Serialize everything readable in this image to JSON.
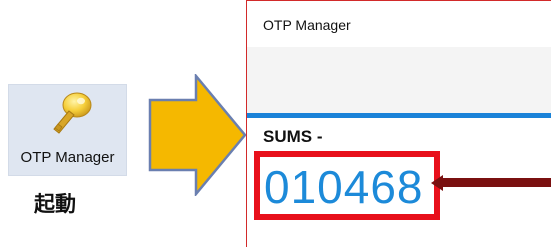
{
  "desktop": {
    "shortcut_label": "OTP Manager",
    "launch_label": "起動"
  },
  "window": {
    "title": "OTP Manager",
    "account_name": "SUMS -",
    "otp_code": "010468"
  },
  "colors": {
    "accent_line": "#1a82d8",
    "otp_text": "#1c8ad9",
    "highlight_box": "#e8101b",
    "pointer": "#7a1010",
    "arrow_fill": "#f5b800",
    "arrow_stroke": "#6a7fb0"
  },
  "icons": {
    "shortcut": "key-icon",
    "transition": "right-arrow-icon"
  }
}
